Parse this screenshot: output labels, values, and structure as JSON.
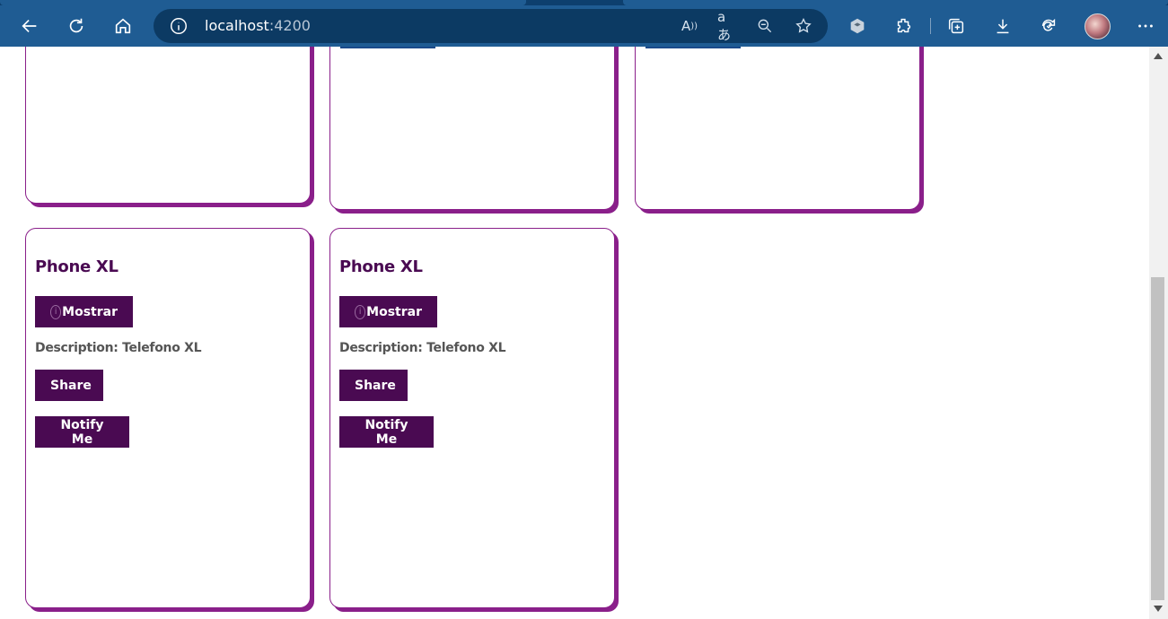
{
  "browser": {
    "url_host": "localhost",
    "url_port": ":4200",
    "icons": [
      "back-icon",
      "refresh-icon",
      "home-icon",
      "site-info-icon",
      "read-aloud-icon",
      "translate-icon",
      "zoom-out-icon",
      "favorite-add-icon",
      "extension-layers-icon",
      "extensions-icon",
      "collections-icon",
      "downloads-icon",
      "performance-icon",
      "profile-avatar",
      "more-icon"
    ],
    "read_aloud_glyph": "A",
    "translate_glyph": "aあ"
  },
  "products": [
    {
      "name": "Phone XL",
      "show_label": "Mostrar",
      "description_label": "Description:",
      "description": "Telefono XL",
      "share_label": "Share",
      "notify_label": "Notify Me"
    },
    {
      "name": "Phone XL",
      "show_label": "Mostrar",
      "description_label": "Description:",
      "description": "Telefono XL",
      "share_label": "Share",
      "notify_label": "Notify Me"
    }
  ],
  "colors": {
    "browser_toolbar": "#1f5c93",
    "address_bar": "#0c3a63",
    "card_border": "#8a1f8a",
    "button_bg": "#4a0a52",
    "title_text": "#4a0a52",
    "description_text": "#555555"
  }
}
